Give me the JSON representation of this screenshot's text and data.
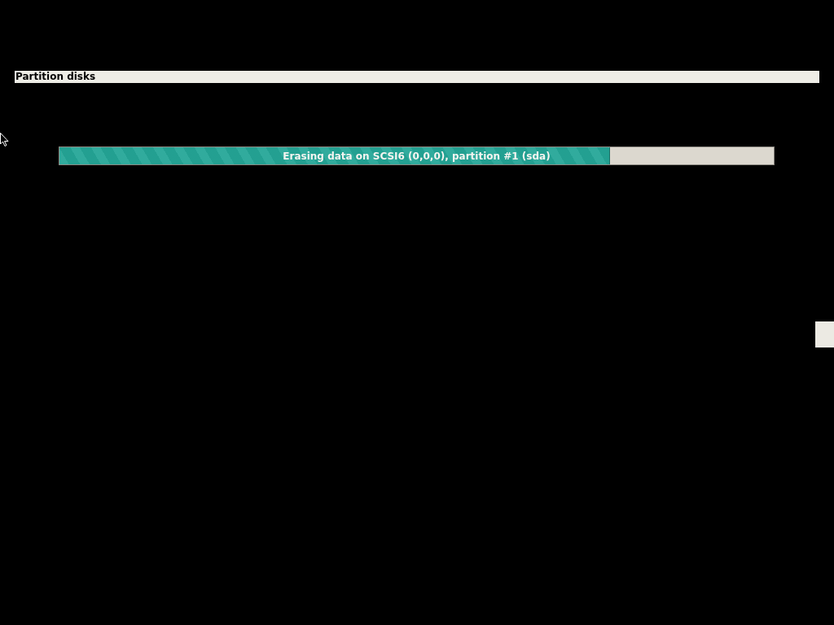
{
  "window": {
    "title": "Partition disks"
  },
  "progress": {
    "label": "Erasing data on SCSI6 (0,0,0), partition #1 (sda)",
    "level": 0.771
  }
}
